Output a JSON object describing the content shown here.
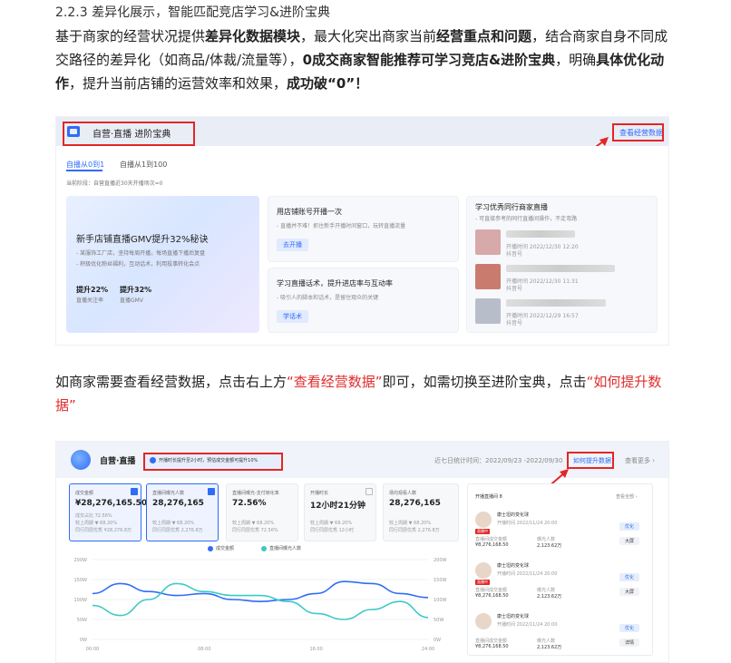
{
  "article": {
    "heading": "2.2.3 差异化展示，智能匹配竞店学习&进阶宝典",
    "para1": {
      "s1": "基于商家的经营状况提供",
      "b1": "差异化数据模块",
      "s2": "，最大化突出商家当前",
      "b2": "经营重点和问题",
      "s3": "，结合商家自身不同成交路径的差异化（如商品/体裁/流量等），",
      "b3": "0成交商家智能推荐可学习竞店&进阶宝典",
      "s4": "，明确",
      "b4": "具体优化动作",
      "s5": "，提升当前店铺的运营效率和效果，",
      "b5": "成功破“0”！"
    },
    "para2": {
      "s1": "如商家需要查看经营数据，点击右上方",
      "r1": "“查看经营数据”",
      "s2": "即可，如需切换至进阶宝典，点击",
      "r2": "“如何提升数据”"
    }
  },
  "shot1": {
    "title": "自营·直播 进阶宝典",
    "link": "查看经营数据",
    "tabs": [
      "自播从0到1",
      "自播从1到100"
    ],
    "stage": "当前阶段：自营直播近30天开播场次=0",
    "banner": {
      "title": "新手店铺直播GMV提升32%秘诀",
      "line1": "- 某服饰工厂店，坚持每周开播，每场直播下播后复盘",
      "line2": "- 积极优化粉丝福利，互动话术，利用投事转化会点",
      "stats": [
        {
          "value": "提升22%",
          "label": "直播关注率"
        },
        {
          "value": "提升32%",
          "label": "直播GMV"
        }
      ]
    },
    "card1": {
      "title": "用店铺账号开播一次",
      "sub": "- 直播并不难！抓住新手开播时间窗口，玩转直播流量",
      "button": "去开播"
    },
    "card2": {
      "title": "学习直播话术，提升进店率与互动率",
      "sub": "- 吸引人的脚本和话术，是留住观众的关键",
      "button": "学话术"
    },
    "card3": {
      "title": "学习优秀同行商家直播",
      "sub": "- 可直接参考的同行直播间操作，不走弯路",
      "items": [
        {
          "time": "开播时间 2022/12/30 12:20",
          "author": "抖音号"
        },
        {
          "time": "开播时间 2022/12/30 11:31",
          "author": "抖音号"
        },
        {
          "time": "开播时间 2022/12/29 16:57",
          "author": "抖音号"
        }
      ]
    }
  },
  "shot2": {
    "brand": "自营·直播",
    "notice": "开播时长提升至2小时，预估成交金额可提升10%",
    "range": "近七日统计时间：2022/09/23 -2022/09/30",
    "how": "如何提升数据?",
    "more": "查看更多 ›",
    "metrics": [
      {
        "title": "成交金额",
        "value": "¥28,276,165.50",
        "sub1": "成交占比 72.56%",
        "sub2": "较上周期 ▼ 68.20%",
        "sub3": "同行同层优秀 ¥28,276.8万",
        "selected": true
      },
      {
        "title": "直播间曝光人数",
        "value": "28,276,165",
        "sub1": "",
        "sub2": "较上周期 ▼ 68.20%",
        "sub3": "同行同层优秀 2,276.8万",
        "selected": true
      },
      {
        "title": "直播间曝光-支付转化率",
        "value": "72.56%",
        "sub1": "",
        "sub2": "较上周期 ▼ 68.20%",
        "sub3": "同行同层优秀 72.56%",
        "selected": false
      },
      {
        "title": "开播时长",
        "value": "12小时21分钟",
        "sub1": "",
        "sub2": "较上周期 ▼ 68.20%",
        "sub3": "同行同层优秀 12小时",
        "selected": false
      },
      {
        "title": "场均观看人数",
        "value": "28,276,165",
        "sub1": "",
        "sub2": "较上周期 ▼ 68.20%",
        "sub3": "同行同层优秀 2,276.8万",
        "selected": false
      }
    ],
    "legend": [
      "成交金额",
      "直播间曝光人数"
    ],
    "y_left": [
      "200W",
      "150W",
      "100W",
      "50W",
      "0W"
    ],
    "y_right": [
      "200W",
      "150W",
      "100W",
      "50W",
      "0W"
    ],
    "x_ticks": [
      "00:00",
      "08:00",
      "16:00",
      "24:00"
    ],
    "side": {
      "head": "开播直播间 8",
      "all": "查看全部 ›",
      "rooms": [
        {
          "name": "康士坦的变化球",
          "time": "开播时间 2022/11/24 20:00",
          "live": "直播中",
          "gmv_l": "直播间成交金额",
          "gmv": "¥8,276,168.50",
          "exp_l": "曝光人数",
          "exp": "2,123.62万",
          "t1": "优化",
          "t2": "大屏"
        },
        {
          "name": "康士坦的变化球",
          "time": "开播时间 2022/11/24 20:00",
          "live": "直播中",
          "gmv_l": "直播间成交金额",
          "gmv": "¥8,276,168.50",
          "exp_l": "曝光人数",
          "exp": "2,123.62万",
          "t1": "优化",
          "t2": "大屏"
        },
        {
          "name": "康士坦的变化球",
          "time": "开播时间 2022/11/24 20:00",
          "live": "",
          "gmv_l": "直播间成交金额",
          "gmv": "¥8,276,168.50",
          "exp_l": "曝光人数",
          "exp": "2,123.62万",
          "t1": "优化",
          "t2": "详情"
        }
      ]
    },
    "colors": {
      "blue": "#2f6df6",
      "teal": "#3ec9c6"
    }
  },
  "chart_data": {
    "type": "line",
    "x": [
      "00:00",
      "02:00",
      "04:00",
      "06:00",
      "08:00",
      "10:00",
      "12:00",
      "14:00",
      "16:00",
      "18:00",
      "20:00",
      "22:00",
      "24:00"
    ],
    "series": [
      {
        "name": "成交金额",
        "values": [
          115,
          140,
          120,
          110,
          115,
          100,
          95,
          100,
          115,
          145,
          140,
          115,
          105
        ]
      },
      {
        "name": "直播间曝光人数",
        "values": [
          85,
          60,
          100,
          140,
          120,
          110,
          110,
          95,
          65,
          50,
          75,
          95,
          55
        ]
      }
    ],
    "ylim": [
      0,
      200
    ],
    "legend_position": "top"
  }
}
